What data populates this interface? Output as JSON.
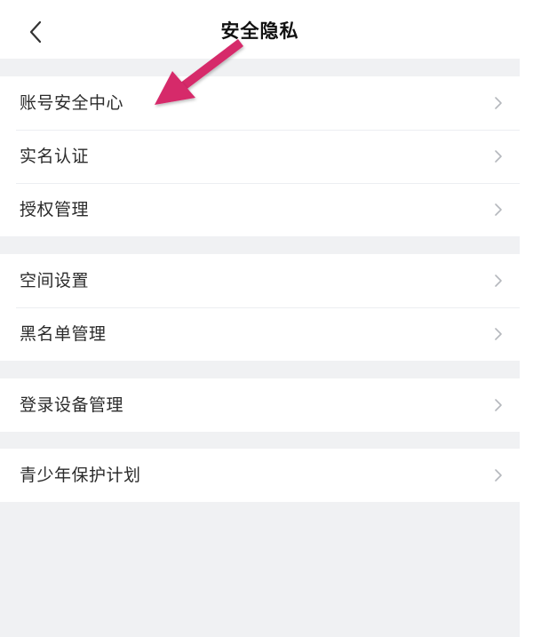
{
  "header": {
    "title": "安全隐私",
    "back_icon": "chevron-left-icon"
  },
  "groups": [
    {
      "items": [
        {
          "label": "账号安全中心"
        },
        {
          "label": "实名认证"
        },
        {
          "label": "授权管理"
        }
      ]
    },
    {
      "items": [
        {
          "label": "空间设置"
        },
        {
          "label": "黑名单管理"
        }
      ]
    },
    {
      "items": [
        {
          "label": "登录设备管理"
        }
      ]
    },
    {
      "items": [
        {
          "label": "青少年保护计划"
        }
      ]
    }
  ],
  "row_chevron_icon": "chevron-right-icon",
  "annotation": {
    "icon": "pointer-arrow-icon",
    "color": "#d6296b",
    "target": "账号安全中心"
  },
  "colors": {
    "background": "#f0f1f3",
    "surface": "#ffffff",
    "text": "#2b2b2b",
    "chevron": "#b5b8bd"
  }
}
